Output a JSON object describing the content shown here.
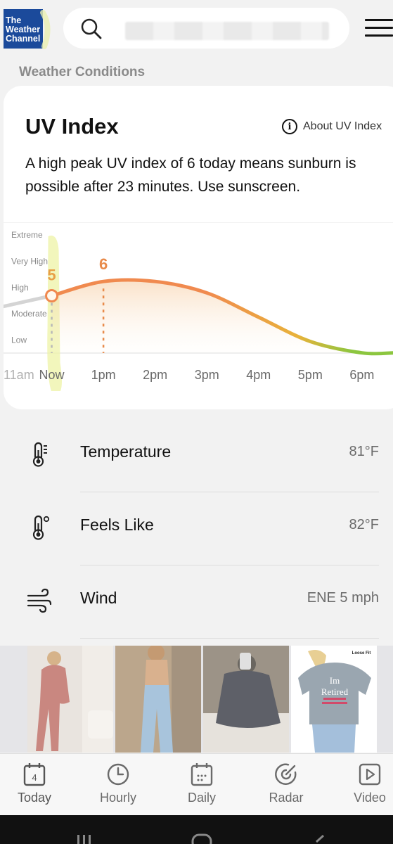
{
  "header": {
    "logo_lines": [
      "The",
      "Weather",
      "Channel"
    ],
    "icons": {
      "search": "search-icon",
      "menu": "hamburger-menu-icon"
    }
  },
  "section_title": "Weather Conditions",
  "uv": {
    "title": "UV Index",
    "about_label": "About UV Index",
    "description": "A high peak UV index of 6 today means sunburn is possible after 23 minutes. Use sunscreen."
  },
  "chart_data": {
    "type": "area",
    "title": "",
    "levels": [
      "Extreme",
      "Very High",
      "High",
      "Moderate",
      "Low"
    ],
    "x_labels": [
      "11am",
      "Now",
      "1pm",
      "2pm",
      "3pm",
      "4pm",
      "5pm",
      "6pm"
    ],
    "series": [
      {
        "values": [
          [
            11,
            4.2
          ],
          [
            12,
            5
          ],
          [
            13,
            6
          ],
          [
            14,
            6
          ],
          [
            15,
            5.2
          ],
          [
            16,
            3.5
          ],
          [
            17,
            1.8
          ],
          [
            18,
            1
          ],
          [
            18.6,
            1
          ]
        ]
      }
    ],
    "markers": [
      {
        "label": "5",
        "x": 12
      },
      {
        "label": "6",
        "x": 13
      }
    ],
    "ylim": [
      0,
      10
    ],
    "xlim": [
      11,
      18.6
    ],
    "colors": {
      "past": "#cfcfcf",
      "high": "#f0884e",
      "moderate": "#e8b23a",
      "low": "#8cc63f",
      "marker": "#e88a4a"
    }
  },
  "conditions": [
    {
      "label": "Temperature",
      "value": "81°F",
      "icon": "thermometer-icon"
    },
    {
      "label": "Feels Like",
      "value": "82°F",
      "icon": "thermometer-degree-icon"
    },
    {
      "label": "Wind",
      "value": "ENE 5 mph",
      "icon": "wind-icon"
    }
  ],
  "ad": {
    "texts": [
      "Loose Fit",
      "Im",
      "Retired"
    ]
  },
  "nav": [
    {
      "label": "Today",
      "icon": "calendar-today-icon",
      "day": "4"
    },
    {
      "label": "Hourly",
      "icon": "clock-icon"
    },
    {
      "label": "Daily",
      "icon": "calendar-daily-icon"
    },
    {
      "label": "Radar",
      "icon": "radar-icon"
    },
    {
      "label": "Video",
      "icon": "video-play-icon"
    }
  ]
}
